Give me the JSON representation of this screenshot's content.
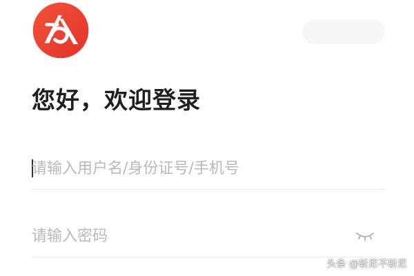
{
  "header": {
    "greeting": "您好，欢迎登录"
  },
  "colors": {
    "brand_red": "#e8392b",
    "brand_orange": "#f26a3b"
  },
  "icons": {
    "logo": "app-logo",
    "password_toggle": "eye-closed-icon"
  },
  "form": {
    "username": {
      "value": "",
      "placeholder": "请输入用户名/身份证号/手机号"
    },
    "password": {
      "value": "",
      "placeholder": "请输入密码"
    }
  },
  "watermark": {
    "text": "头条 @斩尼不斩尼"
  }
}
